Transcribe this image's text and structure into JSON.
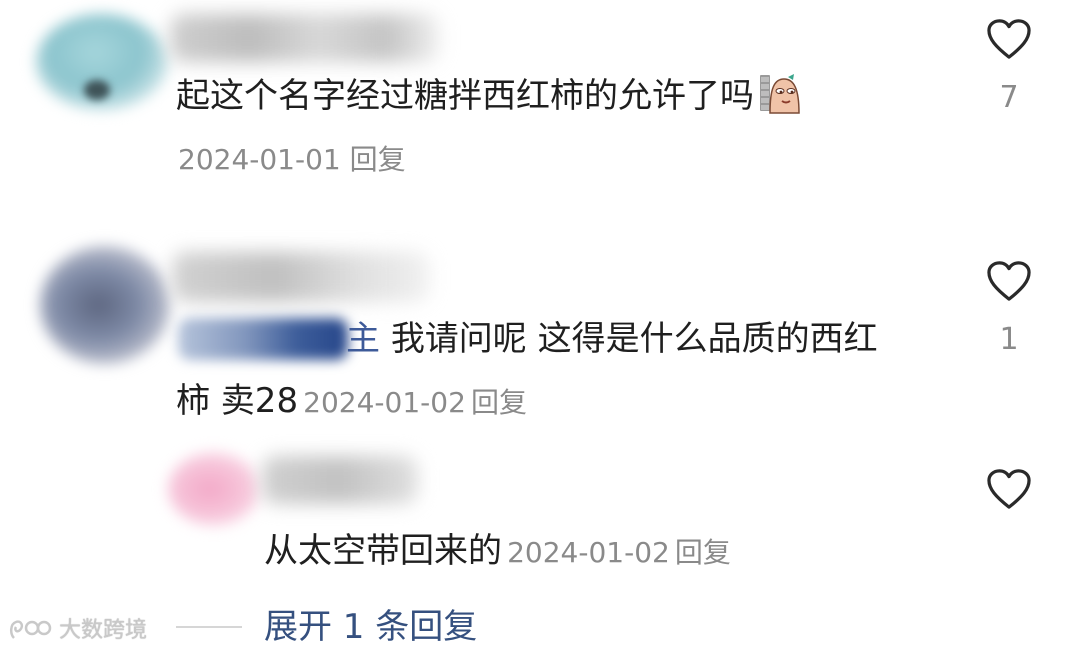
{
  "comments": [
    {
      "text": "起这个名字经过糖拌西红柿的允许了吗",
      "date": "2024-01-01",
      "reply_label": "回复",
      "likes": "7"
    },
    {
      "mention_tail": "主",
      "text_line1": "我请问呢 这得是什么品质的西红",
      "text_line2": "柿 卖28",
      "date": "2024-01-02",
      "reply_label": "回复",
      "likes": "1"
    },
    {
      "text": "从太空带回来的",
      "date": "2024-01-02",
      "reply_label": "回复",
      "likes": ""
    }
  ],
  "expand": {
    "label": "展开 1 条回复"
  },
  "watermark": {
    "text": "大数跨境"
  },
  "icons": {
    "like": "heart-outline-icon",
    "sticker": "peeking-bean-sticker-icon",
    "watermark_logo": "dashuju-logo-icon"
  },
  "colors": {
    "meta_gray": "#8a8a8a",
    "mention_blue": "#3d5a99",
    "expand_blue": "#35507f"
  }
}
